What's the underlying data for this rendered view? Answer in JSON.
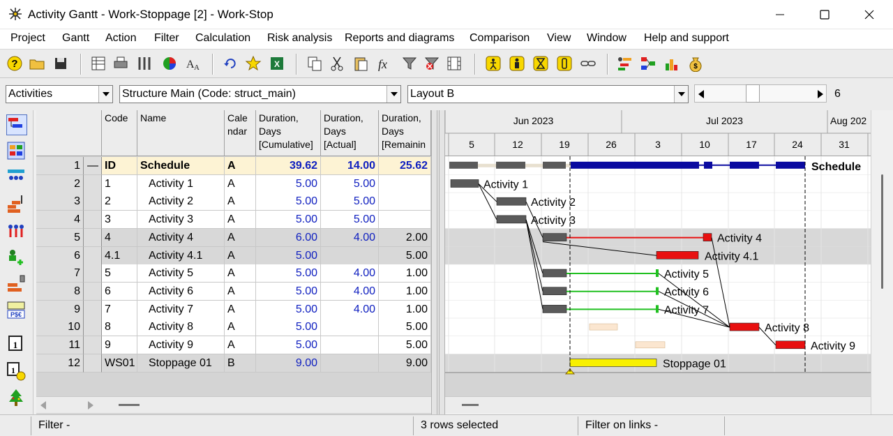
{
  "window": {
    "title": "Activity Gantt - Work-Stoppage [2] - Work-Stop",
    "minimize_icon": "minimize-icon",
    "maximize_icon": "maximize-icon",
    "close_icon": "close-icon"
  },
  "menu": [
    "Project",
    "Gantt",
    "Action",
    "Filter",
    "Calculation",
    "Risk analysis",
    "Reports and diagrams",
    "Comparison",
    "View",
    "Window",
    "Help and support"
  ],
  "selectors": {
    "object_type": "Activities",
    "structure": "Structure Main (Code: struct_main)",
    "layout": "Layout B",
    "zoom_value": "6"
  },
  "table": {
    "columns": [
      {
        "key": "code",
        "label": "Code"
      },
      {
        "key": "name",
        "label": "Name"
      },
      {
        "key": "calendar",
        "label": "Cale ndar"
      },
      {
        "key": "dur_cum",
        "label": "Duration, Days [Cumulative]"
      },
      {
        "key": "dur_act",
        "label": "Duration, Days [Actual]"
      },
      {
        "key": "dur_rem",
        "label": "Duration, Days [Remainin"
      }
    ],
    "rows": [
      {
        "num": "1",
        "marker": "—",
        "code": "ID",
        "name": "Schedule",
        "calendar": "A",
        "dur_cum": "39.62",
        "dur_act": "14.00",
        "dur_rem": "25.62",
        "type": "summary"
      },
      {
        "num": "2",
        "marker": "",
        "code": "1",
        "name": "Activity 1",
        "calendar": "A",
        "dur_cum": "5.00",
        "dur_act": "5.00",
        "dur_rem": "",
        "type": "normal"
      },
      {
        "num": "3",
        "marker": "",
        "code": "2",
        "name": "Activity 2",
        "calendar": "A",
        "dur_cum": "5.00",
        "dur_act": "5.00",
        "dur_rem": "",
        "type": "normal"
      },
      {
        "num": "4",
        "marker": "",
        "code": "3",
        "name": "Activity 3",
        "calendar": "A",
        "dur_cum": "5.00",
        "dur_act": "5.00",
        "dur_rem": "",
        "type": "normal"
      },
      {
        "num": "5",
        "marker": "",
        "code": "4",
        "name": "Activity 4",
        "calendar": "A",
        "dur_cum": "6.00",
        "dur_act": "4.00",
        "dur_rem": "2.00",
        "type": "selected"
      },
      {
        "num": "6",
        "marker": "",
        "code": "4.1",
        "name": "Activity 4.1",
        "calendar": "A",
        "dur_cum": "5.00",
        "dur_act": "",
        "dur_rem": "5.00",
        "type": "selected"
      },
      {
        "num": "7",
        "marker": "",
        "code": "5",
        "name": "Activity 5",
        "calendar": "A",
        "dur_cum": "5.00",
        "dur_act": "4.00",
        "dur_rem": "1.00",
        "type": "normal"
      },
      {
        "num": "8",
        "marker": "",
        "code": "6",
        "name": "Activity 6",
        "calendar": "A",
        "dur_cum": "5.00",
        "dur_act": "4.00",
        "dur_rem": "1.00",
        "type": "normal"
      },
      {
        "num": "9",
        "marker": "",
        "code": "7",
        "name": "Activity 7",
        "calendar": "A",
        "dur_cum": "5.00",
        "dur_act": "4.00",
        "dur_rem": "1.00",
        "type": "normal"
      },
      {
        "num": "10",
        "marker": "",
        "code": "8",
        "name": "Activity 8",
        "calendar": "A",
        "dur_cum": "5.00",
        "dur_act": "",
        "dur_rem": "5.00",
        "type": "normal"
      },
      {
        "num": "11",
        "marker": "",
        "code": "9",
        "name": "Activity 9",
        "calendar": "A",
        "dur_cum": "5.00",
        "dur_act": "",
        "dur_rem": "5.00",
        "type": "normal"
      },
      {
        "num": "12",
        "marker": "",
        "code": "WS01",
        "name": "Stoppage 01",
        "calendar": "B",
        "dur_cum": "9.00",
        "dur_act": "",
        "dur_rem": "9.00",
        "type": "selected"
      }
    ]
  },
  "gantt": {
    "months": [
      "Jun 2023",
      "Jul 2023",
      "Aug 202"
    ],
    "weeks": [
      "5",
      "12",
      "19",
      "26",
      "3",
      "10",
      "17",
      "24",
      "31"
    ],
    "bar_labels": [
      "Schedule",
      "Activity 1",
      "Activity 2",
      "Activity 3",
      "Activity 4",
      "Activity 4.1",
      "Activity 5",
      "Activity 6",
      "Activity 7",
      "Activity 8",
      "Activity 9",
      "Stoppage 01"
    ],
    "colors": {
      "actual": "#5a5a5a",
      "summary": "#0a0aa0",
      "critical": "#e81010",
      "progress_line": "#20c020",
      "stoppage": "#f8f000",
      "baseline": "#fbe6d0",
      "selected_row": "#d8d8d8",
      "summary_row": "#fdf3d4"
    }
  },
  "status": {
    "filter": "Filter -",
    "selection": "3 rows selected",
    "link_filter": "Filter on links -"
  }
}
